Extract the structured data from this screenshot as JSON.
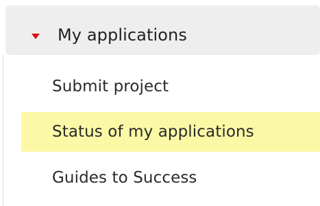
{
  "menu": {
    "header": {
      "title": "My applications",
      "icon": "caret-down-icon",
      "icon_color": "#e20a16",
      "expanded": true
    },
    "items": [
      {
        "label": "Submit project",
        "highlighted": false
      },
      {
        "label": "Status of my applications",
        "highlighted": true
      },
      {
        "label": "Guides to Success",
        "highlighted": false
      }
    ],
    "highlight_color": "#fbf9a6"
  }
}
